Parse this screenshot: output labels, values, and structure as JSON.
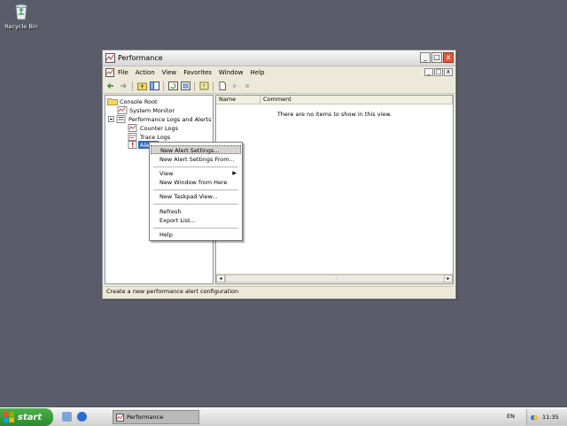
{
  "desktop": {
    "recycle_bin_label": "Recycle Bin"
  },
  "window": {
    "title": "Performance",
    "menu": [
      "File",
      "Action",
      "View",
      "Favorites",
      "Window",
      "Help"
    ],
    "mdi_buttons": [
      "_",
      "□",
      "x"
    ],
    "title_buttons": [
      "_",
      "□",
      "x"
    ]
  },
  "tree": {
    "nodes": [
      "Console Root",
      "System Monitor",
      "Performance Logs and Alerts",
      "Counter Logs",
      "Trace Logs",
      "Alerts"
    ]
  },
  "list": {
    "columns": [
      "Name",
      "Comment"
    ],
    "empty_message": "There are no items to show in this view."
  },
  "context_menu": {
    "items": [
      "New Alert Settings...",
      "New Alert Settings From...",
      "View",
      "New Window from Here",
      "New Taskpad View...",
      "Refresh",
      "Export List...",
      "Help"
    ],
    "highlighted_index": 0
  },
  "statusbar": {
    "text": "Create a new performance alert configuration"
  },
  "taskbar": {
    "start_label": "start",
    "task_label": "Performance",
    "language": "EN",
    "clock": "11:35"
  },
  "colors": {
    "desktop": "#5b5c69",
    "start_green": "#3c9e3c",
    "alert_red": "#d32020"
  }
}
